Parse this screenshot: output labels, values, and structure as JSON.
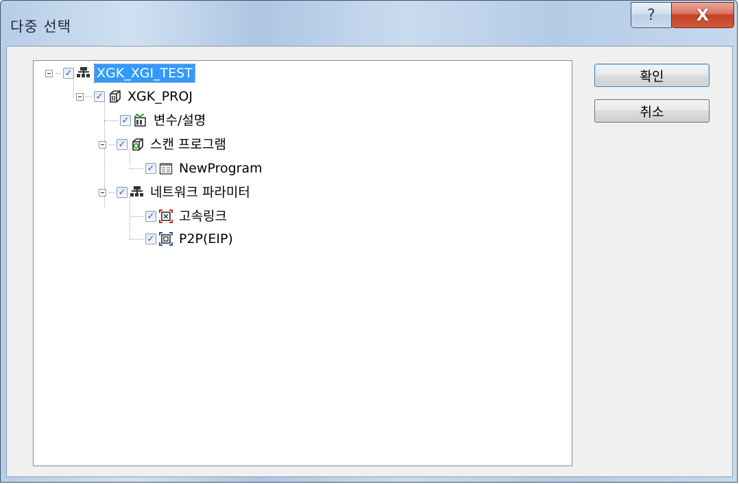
{
  "window": {
    "title": "다중 선택",
    "help_glyph": "?",
    "close_glyph": "X"
  },
  "tree": {
    "items": [
      {
        "label": "XGK_XGI_TEST",
        "icon": "network-icon",
        "checked": true,
        "selected": true
      },
      {
        "label": "XGK_PROJ",
        "icon": "plc-cpu-icon",
        "checked": true,
        "selected": false
      },
      {
        "label": "변수/설명",
        "icon": "variables-icon",
        "checked": true,
        "selected": false
      },
      {
        "label": "스캔 프로그램",
        "icon": "scan-program-icon",
        "checked": true,
        "selected": false
      },
      {
        "label": "NewProgram",
        "icon": "program-file-icon",
        "checked": true,
        "selected": false
      },
      {
        "label": "네트워크 파라미터",
        "icon": "network-icon",
        "checked": true,
        "selected": false
      },
      {
        "label": "고속링크",
        "icon": "highspeed-link-icon",
        "checked": true,
        "selected": false
      },
      {
        "label": "P2P(EIP)",
        "icon": "p2p-icon",
        "checked": true,
        "selected": false
      }
    ]
  },
  "buttons": {
    "ok_label": "확인",
    "cancel_label": "취소"
  },
  "colors": {
    "selection": "#3399ff",
    "check": "#3455a0",
    "close_button": "#c24228"
  }
}
